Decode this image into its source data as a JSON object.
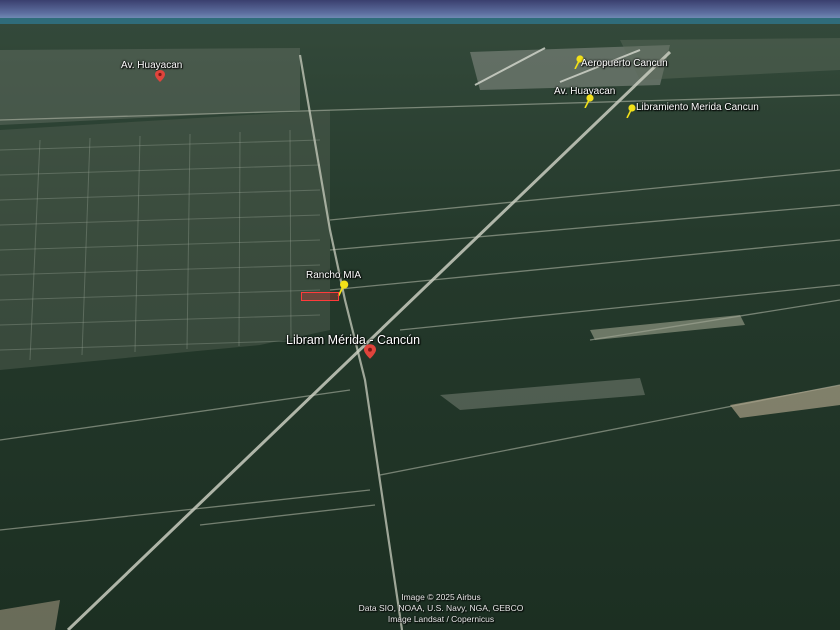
{
  "map": {
    "placemarks": [
      {
        "id": "av-huayacan-west",
        "label": "Av. Huayacan",
        "pin_color": "#e0443c",
        "pin_type": "red-balloon-icon"
      },
      {
        "id": "aeropuerto-cancun",
        "label": "Aeropuerto Cancun",
        "pin_color": "#f2e019",
        "pin_type": "yellow-pushpin-icon"
      },
      {
        "id": "av-huayacan-east",
        "label": "Av. Huayacan",
        "pin_color": "#f2e019",
        "pin_type": "yellow-pushpin-icon"
      },
      {
        "id": "libramiento",
        "label": "Libramiento Merida Cancun",
        "pin_color": "#f2e019",
        "pin_type": "yellow-pushpin-icon"
      },
      {
        "id": "rancho-mia",
        "label": "Rancho MIA",
        "pin_color": "#f2e019",
        "pin_type": "yellow-pushpin-icon"
      },
      {
        "id": "libram-merida",
        "label": "Libram Mérida - Cancún",
        "pin_color": "#e0443c",
        "pin_type": "red-balloon-icon"
      }
    ],
    "parcel_outline_color": "#ff3b3b",
    "attribution": {
      "line1": "Image © 2025 Airbus",
      "line2": "Data SIO, NOAA, U.S. Navy, NGA, GEBCO",
      "line3": "Image Landsat / Copernicus"
    }
  }
}
